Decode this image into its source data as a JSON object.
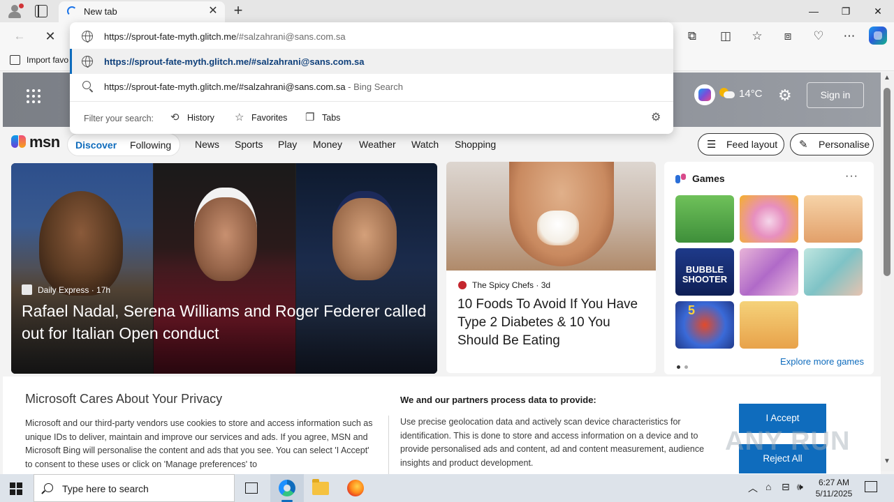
{
  "browser": {
    "tab_title": "New tab",
    "tab_close_glyph": "✕",
    "new_tab_glyph": "+",
    "window_controls": [
      "—",
      "❐",
      "✕"
    ],
    "toolbar_glyphs": {
      "back": "←",
      "stop": "✕",
      "extensions": "⧉",
      "split": "◫",
      "favorites": "☆",
      "collections": "⧈",
      "performance": "♡",
      "more": "⋯"
    },
    "favorites_bar_item": "Import favo"
  },
  "omnibox": {
    "input_url_host": "https://sprout-fate-myth.glitch.me",
    "input_url_rest": "/#salzahrani@sans.com.sa",
    "suggestion_url": "https://sprout-fate-myth.glitch.me/#salzahrani@sans.com.sa",
    "bing_query": "https://sprout-fate-myth.glitch.me/#salzahrani@sans.com.sa",
    "bing_suffix": " - Bing Search",
    "filter_label": "Filter your search:",
    "filters": [
      {
        "label": "History",
        "icon": "history-icon"
      },
      {
        "label": "Favorites",
        "icon": "star-icon"
      },
      {
        "label": "Tabs",
        "icon": "tabs-icon"
      }
    ],
    "filter_glyphs": {
      "history": "⟲",
      "favorites": "☆",
      "tabs": "❐",
      "settings": "⚙"
    }
  },
  "msn": {
    "logo_text": "msn",
    "weather_temp": "14",
    "weather_unit": "°C",
    "gear_glyph": "⚙",
    "sign_in": "Sign in",
    "segments": [
      "Discover",
      "Following"
    ],
    "nav_links": [
      "News",
      "Sports",
      "Play",
      "Money",
      "Weather",
      "Watch",
      "Shopping"
    ],
    "feed_layout": "Feed layout",
    "personalise": "Personalise",
    "pill_glyphs": {
      "feed_layout": "☰",
      "personalise": "✎"
    },
    "hero": {
      "source": "Daily Express",
      "age": "17h",
      "headline": "Rafael Nadal, Serena Williams and Roger Federer called out for Italian Open conduct"
    },
    "card2": {
      "source": "The Spicy Chefs",
      "age": "3d",
      "headline": "10 Foods To Avoid If You Have Type 2 Diabetes & 10 You Should Be Eating"
    },
    "games": {
      "title": "Games",
      "more_glyph": "···",
      "explore": "Explore more games",
      "tile_labels": [
        "BUBBLE SHOOTER",
        "5"
      ]
    }
  },
  "privacy": {
    "title": "Microsoft Cares About Your Privacy",
    "body": "Microsoft and our third-party vendors use cookies to store and access information such as unique IDs to deliver, maintain and improve our services and ads. If you agree, MSN and Microsoft Bing will personalise the content and ads that you see. You can select 'I Accept' to consent to these uses or click on 'Manage preferences' to",
    "right_title": "We and our partners process data to provide:",
    "right_body": "Use precise geolocation data and actively scan device characteristics for identification. This is done to store and access information on a device and to provide personalised ads and content, ad and content measurement, audience insights and product development.",
    "accept": "I Accept",
    "reject": "Reject All"
  },
  "watermark": "ANY RUN",
  "scroll_glyphs": {
    "up": "▲",
    "down": "▼"
  },
  "taskbar": {
    "search_placeholder": "Type here to search",
    "tray_glyphs": [
      "︿",
      "⌂",
      "⊟",
      "🕪"
    ],
    "time": "6:27 AM",
    "date": "5/11/2025"
  }
}
